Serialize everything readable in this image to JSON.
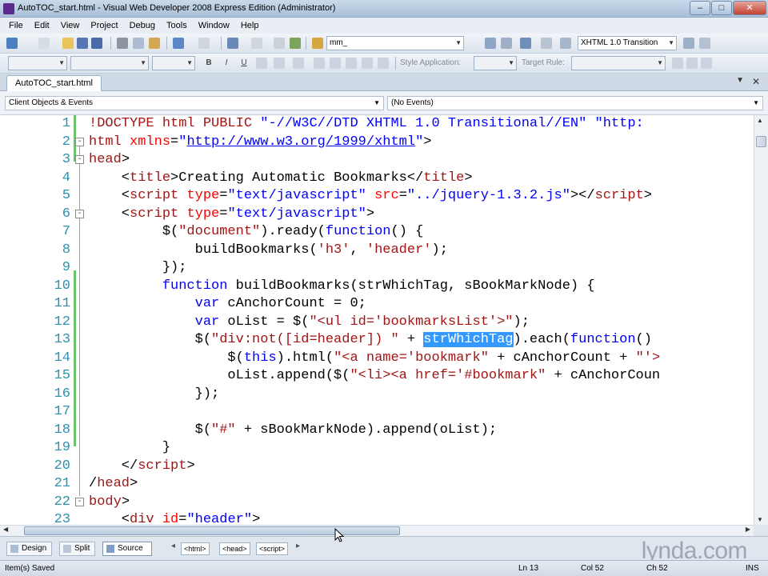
{
  "window": {
    "title": "AutoTOC_start.html - Visual Web Developer 2008 Express Edition (Administrator)",
    "buttons": {
      "minimize": "–",
      "maximize": "□",
      "close": "✕"
    }
  },
  "menu": [
    "File",
    "Edit",
    "View",
    "Project",
    "Debug",
    "Tools",
    "Window",
    "Help"
  ],
  "toolbar": {
    "find_value": "mm_",
    "doctype_value": "XHTML 1.0 Transition",
    "style_application_label": "Style Application:",
    "target_rule_label": "Target Rule:",
    "bold": "B",
    "italic": "I",
    "underline": "U"
  },
  "document_tab": {
    "label": "AutoTOC_start.html",
    "pin": "▼",
    "close": "✕"
  },
  "navbar": {
    "left_value": "Client Objects & Events",
    "right_value": "(No Events)"
  },
  "code": {
    "lines": [
      {
        "n": "1",
        "fold": "",
        "parts": [
          [
            "t",
            "!DOCTYPE html PUBLIC "
          ],
          [
            "s",
            "\"-//W3C//DTD XHTML 1.0 Transitional//EN\""
          ],
          [
            "p",
            " "
          ],
          [
            "s",
            "\"http:"
          ]
        ]
      },
      {
        "n": "2",
        "fold": "-",
        "parts": [
          [
            "t",
            "html "
          ],
          [
            "a",
            "xmlns"
          ],
          [
            "p",
            "="
          ],
          [
            "s",
            "\""
          ],
          [
            "u",
            "http://www.w3.org/1999/xhtml"
          ],
          [
            "s",
            "\""
          ],
          [
            "p",
            ">"
          ]
        ]
      },
      {
        "n": "3",
        "fold": "-",
        "parts": [
          [
            "t",
            "head"
          ],
          [
            "p",
            ">"
          ]
        ]
      },
      {
        "n": "4",
        "fold": "",
        "parts": [
          [
            "p",
            "    <"
          ],
          [
            "t",
            "title"
          ],
          [
            "p",
            ">Creating Automatic Bookmarks</"
          ],
          [
            "t",
            "title"
          ],
          [
            "p",
            ">"
          ]
        ]
      },
      {
        "n": "5",
        "fold": "",
        "parts": [
          [
            "p",
            "    <"
          ],
          [
            "t",
            "script "
          ],
          [
            "a",
            "type"
          ],
          [
            "p",
            "="
          ],
          [
            "s",
            "\"text/javascript\""
          ],
          [
            "p",
            " "
          ],
          [
            "a",
            "src"
          ],
          [
            "p",
            "="
          ],
          [
            "s",
            "\"../jquery-1.3.2.js\""
          ],
          [
            "p",
            "></"
          ],
          [
            "t",
            "script"
          ],
          [
            "p",
            ">"
          ]
        ]
      },
      {
        "n": "6",
        "fold": "-",
        "parts": [
          [
            "p",
            "    <"
          ],
          [
            "t",
            "script "
          ],
          [
            "a",
            "type"
          ],
          [
            "p",
            "="
          ],
          [
            "s",
            "\"text/javascript\""
          ],
          [
            "p",
            ">"
          ]
        ]
      },
      {
        "n": "7",
        "fold": "",
        "parts": [
          [
            "p",
            "         $("
          ],
          [
            "j",
            "\"document\""
          ],
          [
            "p",
            ").ready("
          ],
          [
            "k",
            "function"
          ],
          [
            "p",
            "() {"
          ]
        ]
      },
      {
        "n": "8",
        "fold": "",
        "parts": [
          [
            "p",
            "             buildBookmarks("
          ],
          [
            "j",
            "'h3'"
          ],
          [
            "p",
            ", "
          ],
          [
            "j",
            "'header'"
          ],
          [
            "p",
            ");"
          ]
        ]
      },
      {
        "n": "9",
        "fold": "",
        "parts": [
          [
            "p",
            "         });"
          ]
        ]
      },
      {
        "n": "10",
        "fold": "",
        "parts": [
          [
            "p",
            "         "
          ],
          [
            "k",
            "function"
          ],
          [
            "p",
            " buildBookmarks(strWhichTag, sBookMarkNode) {"
          ]
        ]
      },
      {
        "n": "11",
        "fold": "",
        "parts": [
          [
            "p",
            "             "
          ],
          [
            "k",
            "var"
          ],
          [
            "p",
            " cAnchorCount = 0;"
          ]
        ]
      },
      {
        "n": "12",
        "fold": "",
        "parts": [
          [
            "p",
            "             "
          ],
          [
            "k",
            "var"
          ],
          [
            "p",
            " oList = $("
          ],
          [
            "j",
            "\"<ul id='bookmarksList'>\""
          ],
          [
            "p",
            ");"
          ]
        ]
      },
      {
        "n": "13",
        "fold": "",
        "parts": [
          [
            "p",
            "             $("
          ],
          [
            "j",
            "\"div:not([id=header]) \""
          ],
          [
            "p",
            " + "
          ],
          [
            "x",
            "strWhichTag"
          ],
          [
            "p",
            ").each("
          ],
          [
            "k",
            "function"
          ],
          [
            "p",
            "()"
          ]
        ]
      },
      {
        "n": "14",
        "fold": "",
        "parts": [
          [
            "p",
            "                 $("
          ],
          [
            "k",
            "this"
          ],
          [
            "p",
            ").html("
          ],
          [
            "j",
            "\"<a name='bookmark\""
          ],
          [
            "p",
            " + cAnchorCount + "
          ],
          [
            "j",
            "\"'>"
          ]
        ]
      },
      {
        "n": "15",
        "fold": "",
        "parts": [
          [
            "p",
            "                 oList.append($("
          ],
          [
            "j",
            "\"<li><a href='#bookmark\""
          ],
          [
            "p",
            " + cAnchorCoun"
          ]
        ]
      },
      {
        "n": "16",
        "fold": "",
        "parts": [
          [
            "p",
            "             });"
          ]
        ]
      },
      {
        "n": "17",
        "fold": "",
        "parts": [
          [
            "p",
            ""
          ]
        ]
      },
      {
        "n": "18",
        "fold": "",
        "parts": [
          [
            "p",
            "             $("
          ],
          [
            "j",
            "\"#\""
          ],
          [
            "p",
            " + sBookMarkNode).append(oList);"
          ]
        ]
      },
      {
        "n": "19",
        "fold": "",
        "parts": [
          [
            "p",
            "         }"
          ]
        ]
      },
      {
        "n": "20",
        "fold": "",
        "parts": [
          [
            "p",
            "    </"
          ],
          [
            "t",
            "script"
          ],
          [
            "p",
            ">"
          ]
        ]
      },
      {
        "n": "21",
        "fold": "",
        "parts": [
          [
            "p",
            "/"
          ],
          [
            "t",
            "head"
          ],
          [
            "p",
            ">"
          ]
        ]
      },
      {
        "n": "22",
        "fold": "-",
        "parts": [
          [
            "t",
            "body"
          ],
          [
            "p",
            ">"
          ]
        ]
      },
      {
        "n": "23",
        "fold": "",
        "parts": [
          [
            "p",
            "    <"
          ],
          [
            "t",
            "div "
          ],
          [
            "a",
            "id"
          ],
          [
            "p",
            "="
          ],
          [
            "s",
            "\"header\""
          ],
          [
            "p",
            ">"
          ]
        ]
      }
    ]
  },
  "view_tabs": [
    {
      "label": "Design",
      "active": false
    },
    {
      "label": "Split",
      "active": false
    },
    {
      "label": "Source",
      "active": true
    }
  ],
  "breadcrumbs": [
    "<html>",
    "<head>",
    "<script>"
  ],
  "watermark": "lynda.com",
  "status": {
    "message": "Item(s) Saved",
    "ln": "Ln 13",
    "col": "Col 52",
    "ch": "Ch 52",
    "mode": "INS"
  }
}
